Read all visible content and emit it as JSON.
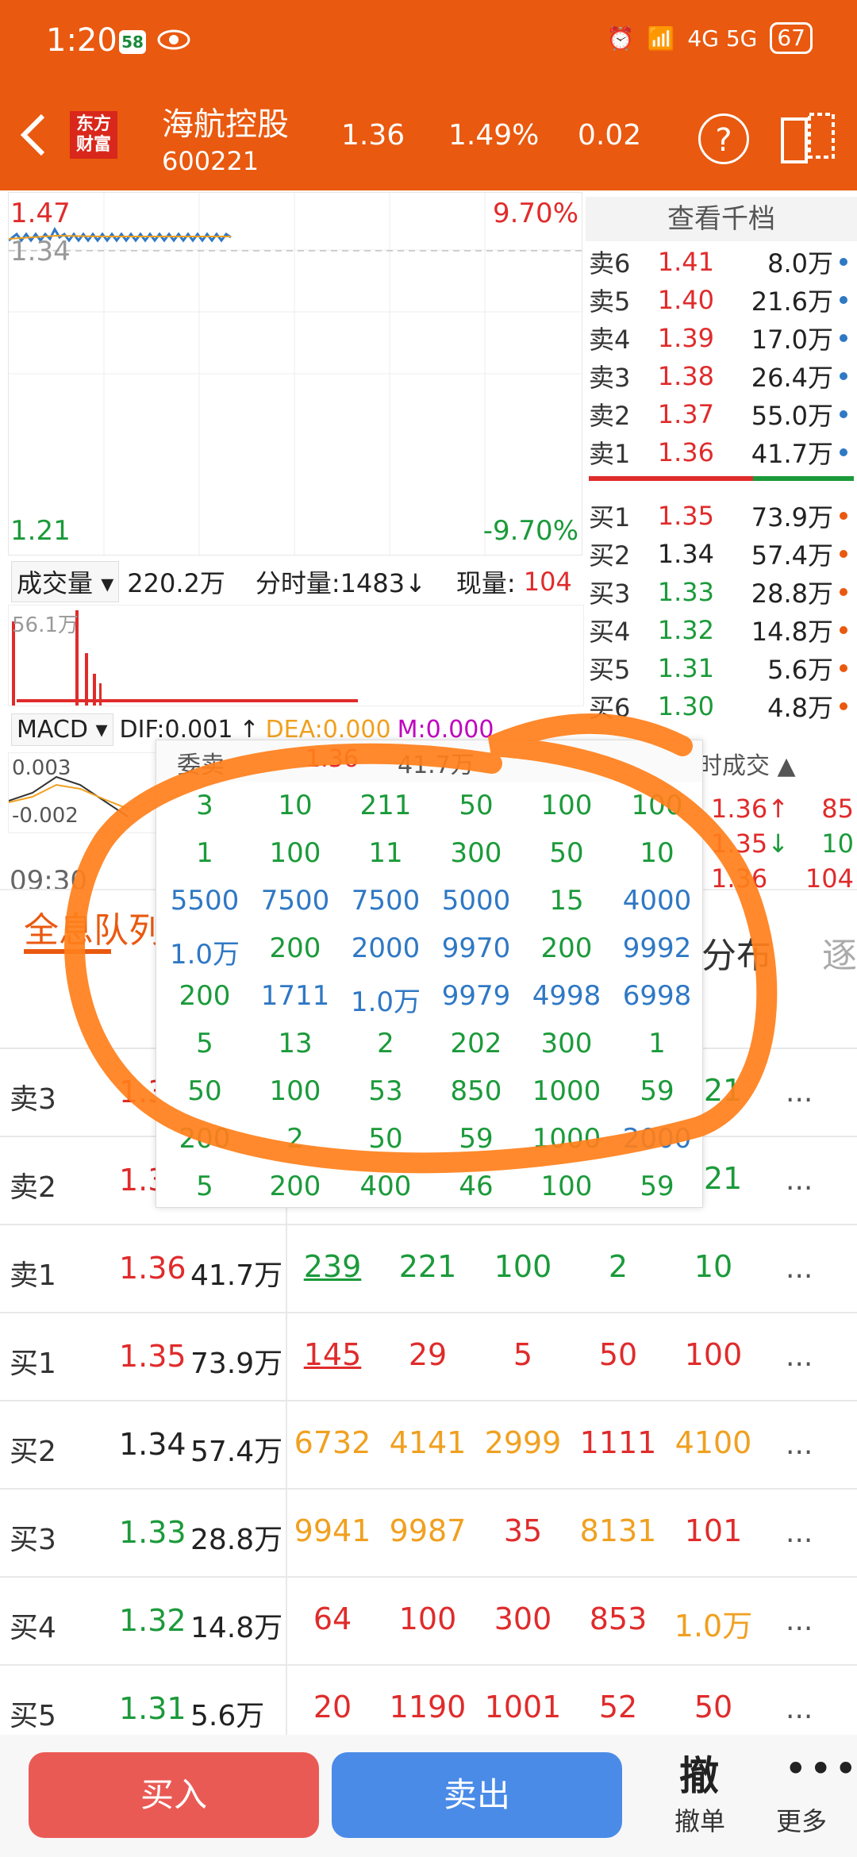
{
  "status": {
    "time": "1:20",
    "badge": "58",
    "network": "4G 5G",
    "battery": "67"
  },
  "header": {
    "logo_line1": "东方",
    "logo_line2": "财富",
    "name": "海航控股",
    "code": "600221",
    "price": "1.36",
    "pct": "1.49%",
    "change": "0.02"
  },
  "chart": {
    "high": "1.47",
    "high_pct": "9.70%",
    "mid": "1.34",
    "low": "1.21",
    "low_pct": "-9.70%"
  },
  "volume_bar": {
    "label": "成交量",
    "total": "220.2万",
    "tick_label": "分时量:1483",
    "now_label": "现量:",
    "now_value": "104",
    "peak": "56.1万"
  },
  "macd_bar": {
    "label": "MACD",
    "dif": "DIF:0.001",
    "dea": "DEA:0.000",
    "m": "M:0.000",
    "top": "0.003",
    "bottom": "-0.002",
    "time": "09:30"
  },
  "orderbook": {
    "title": "查看千档",
    "asks": [
      {
        "label": "卖6",
        "price": "1.41",
        "vol": "8.0万"
      },
      {
        "label": "卖5",
        "price": "1.40",
        "vol": "21.6万"
      },
      {
        "label": "卖4",
        "price": "1.39",
        "vol": "17.0万"
      },
      {
        "label": "卖3",
        "price": "1.38",
        "vol": "26.4万"
      },
      {
        "label": "卖2",
        "price": "1.37",
        "vol": "55.0万"
      },
      {
        "label": "卖1",
        "price": "1.36",
        "vol": "41.7万"
      }
    ],
    "bids": [
      {
        "label": "买1",
        "price": "1.35",
        "vol": "73.9万"
      },
      {
        "label": "买2",
        "price": "1.34",
        "vol": "57.4万"
      },
      {
        "label": "买3",
        "price": "1.33",
        "vol": "28.8万"
      },
      {
        "label": "买4",
        "price": "1.32",
        "vol": "14.8万"
      },
      {
        "label": "买5",
        "price": "1.31",
        "vol": "5.6万"
      },
      {
        "label": "买6",
        "price": "1.30",
        "vol": "4.8万"
      }
    ]
  },
  "ticks": {
    "title": "时成交",
    "rows": [
      {
        "price": "1.36",
        "arrow": "↑",
        "vol": "85"
      },
      {
        "price": "1.35",
        "arrow": "↓",
        "vol": "10"
      },
      {
        "price": "1.36",
        "arrow": "",
        "vol": "104"
      }
    ]
  },
  "popup": {
    "head_label": "委卖",
    "head_price": "1.36",
    "head_vol": "41.7万",
    "rows": [
      [
        {
          "v": "3",
          "c": "green"
        },
        {
          "v": "10",
          "c": "green"
        },
        {
          "v": "211",
          "c": "green"
        },
        {
          "v": "50",
          "c": "green"
        },
        {
          "v": "100",
          "c": "green"
        },
        {
          "v": "100",
          "c": "green"
        }
      ],
      [
        {
          "v": "1",
          "c": "green"
        },
        {
          "v": "100",
          "c": "green"
        },
        {
          "v": "11",
          "c": "green"
        },
        {
          "v": "300",
          "c": "green"
        },
        {
          "v": "50",
          "c": "green"
        },
        {
          "v": "10",
          "c": "green"
        }
      ],
      [
        {
          "v": "5500",
          "c": "blue"
        },
        {
          "v": "7500",
          "c": "blue"
        },
        {
          "v": "7500",
          "c": "blue"
        },
        {
          "v": "5000",
          "c": "blue"
        },
        {
          "v": "15",
          "c": "green"
        },
        {
          "v": "4000",
          "c": "blue"
        }
      ],
      [
        {
          "v": "1.0万",
          "c": "blue"
        },
        {
          "v": "200",
          "c": "green"
        },
        {
          "v": "2000",
          "c": "blue"
        },
        {
          "v": "9970",
          "c": "blue"
        },
        {
          "v": "200",
          "c": "green"
        },
        {
          "v": "9992",
          "c": "blue"
        }
      ],
      [
        {
          "v": "200",
          "c": "green"
        },
        {
          "v": "1711",
          "c": "blue"
        },
        {
          "v": "1.0万",
          "c": "blue"
        },
        {
          "v": "9979",
          "c": "blue"
        },
        {
          "v": "4998",
          "c": "blue"
        },
        {
          "v": "6998",
          "c": "blue"
        }
      ],
      [
        {
          "v": "5",
          "c": "green"
        },
        {
          "v": "13",
          "c": "green"
        },
        {
          "v": "2",
          "c": "green"
        },
        {
          "v": "202",
          "c": "green"
        },
        {
          "v": "300",
          "c": "green"
        },
        {
          "v": "1",
          "c": "green"
        }
      ],
      [
        {
          "v": "50",
          "c": "green"
        },
        {
          "v": "100",
          "c": "green"
        },
        {
          "v": "53",
          "c": "green"
        },
        {
          "v": "850",
          "c": "green"
        },
        {
          "v": "1000",
          "c": "green"
        },
        {
          "v": "59",
          "c": "green"
        }
      ],
      [
        {
          "v": "200",
          "c": "green"
        },
        {
          "v": "2",
          "c": "green"
        },
        {
          "v": "50",
          "c": "green"
        },
        {
          "v": "59",
          "c": "green"
        },
        {
          "v": "1000",
          "c": "green"
        },
        {
          "v": "2000",
          "c": "blue"
        }
      ],
      [
        {
          "v": "5",
          "c": "green"
        },
        {
          "v": "200",
          "c": "green"
        },
        {
          "v": "400",
          "c": "green"
        },
        {
          "v": "46",
          "c": "green"
        },
        {
          "v": "100",
          "c": "green"
        },
        {
          "v": "59",
          "c": "green"
        }
      ]
    ]
  },
  "tabs": {
    "active": "全息队列",
    "other": "分布",
    "more": "逐"
  },
  "queue": [
    {
      "label": "卖3",
      "price": "1.38",
      "vol": "",
      "pc": "red",
      "cells": [],
      "tail": "21"
    },
    {
      "label": "卖2",
      "price": "1.37",
      "vol": "",
      "pc": "red",
      "cells": [],
      "tail": "21"
    },
    {
      "label": "卖1",
      "price": "1.36",
      "vol": "41.7万",
      "pc": "red",
      "cells": [
        {
          "v": "239",
          "c": "green"
        },
        {
          "v": "221",
          "c": "green"
        },
        {
          "v": "100",
          "c": "green"
        },
        {
          "v": "2",
          "c": "green"
        },
        {
          "v": "10",
          "c": "green"
        }
      ],
      "tail": ""
    },
    {
      "label": "买1",
      "price": "1.35",
      "vol": "73.9万",
      "pc": "red",
      "cells": [
        {
          "v": "145",
          "c": "red"
        },
        {
          "v": "29",
          "c": "red"
        },
        {
          "v": "5",
          "c": "red"
        },
        {
          "v": "50",
          "c": "red"
        },
        {
          "v": "100",
          "c": "red"
        }
      ],
      "tail": ""
    },
    {
      "label": "买2",
      "price": "1.34",
      "vol": "57.4万",
      "pc": "dark",
      "cells": [
        {
          "v": "6732",
          "c": "orange"
        },
        {
          "v": "4141",
          "c": "orange"
        },
        {
          "v": "2999",
          "c": "orange"
        },
        {
          "v": "1111",
          "c": "red"
        },
        {
          "v": "4100",
          "c": "orange"
        }
      ],
      "tail": ""
    },
    {
      "label": "买3",
      "price": "1.33",
      "vol": "28.8万",
      "pc": "green",
      "cells": [
        {
          "v": "9941",
          "c": "orange"
        },
        {
          "v": "9987",
          "c": "orange"
        },
        {
          "v": "35",
          "c": "red"
        },
        {
          "v": "8131",
          "c": "orange"
        },
        {
          "v": "101",
          "c": "red"
        }
      ],
      "tail": ""
    },
    {
      "label": "买4",
      "price": "1.32",
      "vol": "14.8万",
      "pc": "green",
      "cells": [
        {
          "v": "64",
          "c": "red"
        },
        {
          "v": "100",
          "c": "red"
        },
        {
          "v": "300",
          "c": "red"
        },
        {
          "v": "853",
          "c": "red"
        },
        {
          "v": "1.0万",
          "c": "orange"
        }
      ],
      "tail": ""
    },
    {
      "label": "买5",
      "price": "1.31",
      "vol": "5.6万",
      "pc": "green",
      "cells": [
        {
          "v": "20",
          "c": "red"
        },
        {
          "v": "1190",
          "c": "red"
        },
        {
          "v": "1001",
          "c": "red"
        },
        {
          "v": "52",
          "c": "red"
        },
        {
          "v": "50",
          "c": "red"
        }
      ],
      "tail": ""
    }
  ],
  "queue_more": "...",
  "bottom": {
    "buy": "买入",
    "sell": "卖出",
    "cancel_icon": "撤",
    "cancel": "撤单",
    "more_icon": "•••",
    "more": "更多"
  },
  "colors": {
    "brand": "#e9590f",
    "up": "#e02b2b",
    "down": "#1b9a3a",
    "highlight": "#ff7f1a"
  }
}
